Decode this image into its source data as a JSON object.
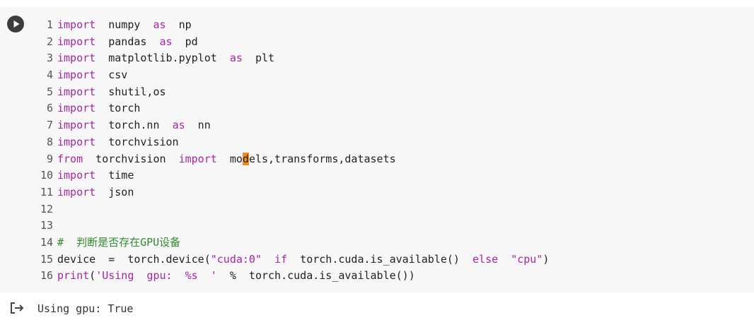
{
  "code_lines": [
    {
      "num": "1",
      "tokens": [
        {
          "t": "import",
          "c": "kw"
        },
        {
          "t": "  numpy  "
        },
        {
          "t": "as",
          "c": "kw"
        },
        {
          "t": "  np"
        }
      ]
    },
    {
      "num": "2",
      "tokens": [
        {
          "t": "import",
          "c": "kw"
        },
        {
          "t": "  pandas  "
        },
        {
          "t": "as",
          "c": "kw"
        },
        {
          "t": "  pd"
        }
      ]
    },
    {
      "num": "3",
      "tokens": [
        {
          "t": "import",
          "c": "kw"
        },
        {
          "t": "  matplotlib.pyplot  "
        },
        {
          "t": "as",
          "c": "kw"
        },
        {
          "t": "  plt"
        }
      ]
    },
    {
      "num": "4",
      "tokens": [
        {
          "t": "import",
          "c": "kw"
        },
        {
          "t": "  csv"
        }
      ]
    },
    {
      "num": "5",
      "tokens": [
        {
          "t": "import",
          "c": "kw"
        },
        {
          "t": "  shutil,os"
        }
      ]
    },
    {
      "num": "6",
      "tokens": [
        {
          "t": "import",
          "c": "kw"
        },
        {
          "t": "  torch"
        }
      ]
    },
    {
      "num": "7",
      "tokens": [
        {
          "t": "import",
          "c": "kw"
        },
        {
          "t": "  torch.nn  "
        },
        {
          "t": "as",
          "c": "kw"
        },
        {
          "t": "  nn"
        }
      ]
    },
    {
      "num": "8",
      "tokens": [
        {
          "t": "import",
          "c": "kw"
        },
        {
          "t": "  torchvision"
        }
      ]
    },
    {
      "num": "9",
      "tokens": [
        {
          "t": "from",
          "c": "kw"
        },
        {
          "t": "  torchvision  "
        },
        {
          "t": "import",
          "c": "kw"
        },
        {
          "t": "  mo"
        },
        {
          "t": "d",
          "c": "cursor-hl"
        },
        {
          "t": "els,transforms,datasets"
        }
      ]
    },
    {
      "num": "10",
      "tokens": [
        {
          "t": "import",
          "c": "kw"
        },
        {
          "t": "  time"
        }
      ]
    },
    {
      "num": "11",
      "tokens": [
        {
          "t": "import",
          "c": "kw"
        },
        {
          "t": "  json"
        }
      ]
    },
    {
      "num": "12",
      "tokens": []
    },
    {
      "num": "13",
      "tokens": []
    },
    {
      "num": "14",
      "tokens": [
        {
          "t": "#  判断是否存在GPU设备",
          "c": "cm"
        }
      ]
    },
    {
      "num": "15",
      "tokens": [
        {
          "t": "device  =  torch.device("
        },
        {
          "t": "\"cuda:0\"",
          "c": "str"
        },
        {
          "t": "  "
        },
        {
          "t": "if",
          "c": "kw"
        },
        {
          "t": "  torch.cuda.is_available()  "
        },
        {
          "t": "else",
          "c": "kw"
        },
        {
          "t": "  "
        },
        {
          "t": "\"cpu\"",
          "c": "str"
        },
        {
          "t": ")"
        }
      ]
    },
    {
      "num": "16",
      "tokens": [
        {
          "t": "print",
          "c": "kw"
        },
        {
          "t": "("
        },
        {
          "t": "'Using  gpu:  %s  '",
          "c": "str"
        },
        {
          "t": "  %  torch.cuda.is_available())"
        }
      ]
    }
  ],
  "output": {
    "text": "Using gpu: True",
    "icon": "output-arrow-icon"
  },
  "run_button": {
    "icon": "play-icon"
  }
}
